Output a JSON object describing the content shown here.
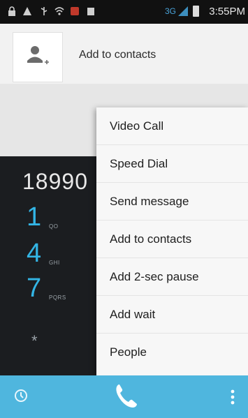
{
  "status_bar": {
    "time": "3:55PM",
    "network": "3G",
    "icons": [
      "lock-icon",
      "warning-icon",
      "usb-icon",
      "wifi-icon",
      "notification-icon",
      "sd-card-icon",
      "signal-icon",
      "battery-icon"
    ]
  },
  "contact_header": {
    "label": "Add to contacts",
    "icon": "add-contact-icon"
  },
  "dialer": {
    "digits": "18990",
    "keys": [
      {
        "digit": "1",
        "letters": "QO"
      },
      {
        "digit": "4",
        "letters": "GHI"
      },
      {
        "digit": "7",
        "letters": "PQRS"
      },
      {
        "digit": "*",
        "letters": ""
      }
    ]
  },
  "menu": {
    "items": [
      {
        "label": "Video Call"
      },
      {
        "label": "Speed Dial"
      },
      {
        "label": "Send message"
      },
      {
        "label": "Add to contacts"
      },
      {
        "label": "Add 2-sec pause"
      },
      {
        "label": "Add wait"
      },
      {
        "label": "People"
      }
    ]
  },
  "action_bar": {
    "icons": [
      "history-icon",
      "call-icon",
      "overflow-menu-icon"
    ],
    "accent": "#4fb6de",
    "key_color": "#33b5e5"
  }
}
